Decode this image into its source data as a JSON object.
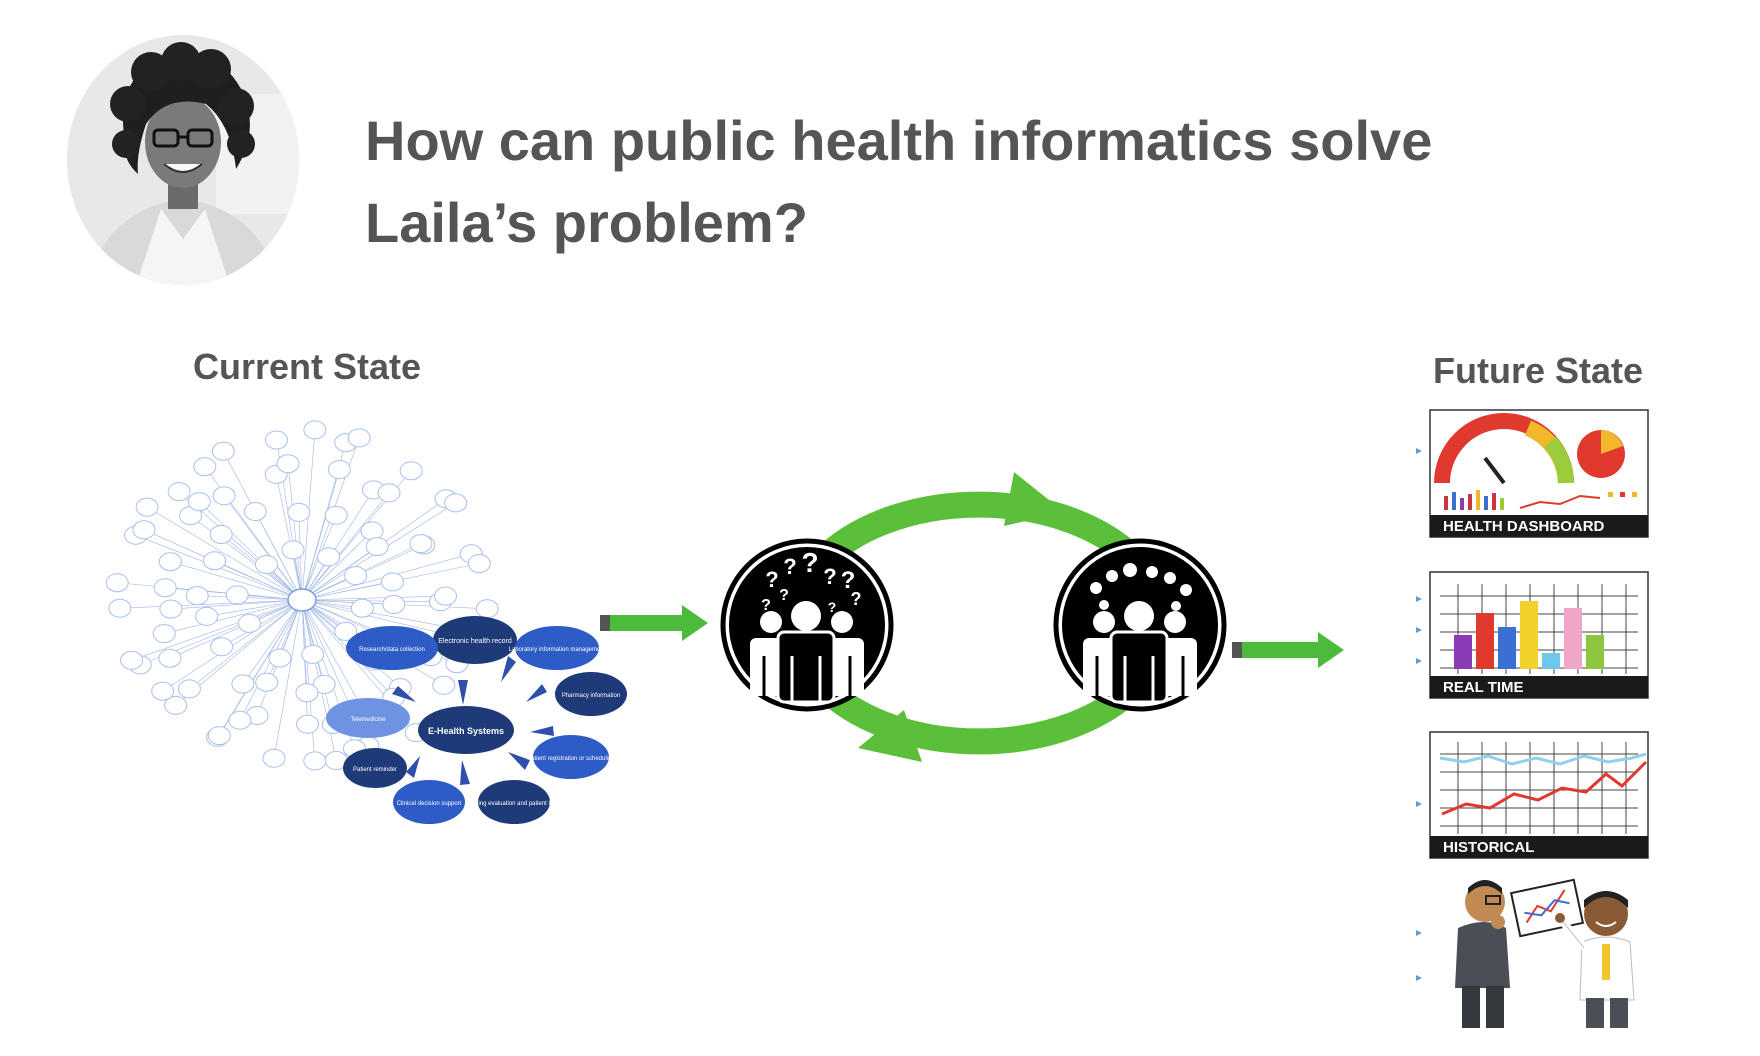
{
  "title": "How can public health informatics solve Laila’s problem?",
  "current_state": {
    "label": "Current State",
    "ehealth_center": "E-Health Systems",
    "ehealth_nodes": [
      "Electronic health record",
      "Laboratory information management",
      "Pharmacy information",
      "Patient registration or scheduling",
      "Monitoring evaluation and patient tracking",
      "Clinical decision support",
      "Patient reminder",
      "Telemedicine",
      "Research/data collection"
    ]
  },
  "future_state": {
    "label": "Future State",
    "panels": [
      "HEALTH DASHBOARD",
      "REAL TIME",
      "HISTORICAL"
    ]
  },
  "colors": {
    "cycle_green": "#5cbf3a",
    "arrow_green": "#4cbb3c",
    "title_gray": "#555555",
    "node_dark": "#1e3a78",
    "node_mid": "#2e5cc7",
    "node_light": "#6f93e3",
    "panel_bar": "#1a1a1a"
  },
  "icons": [
    "person-photo",
    "confused-people-icon",
    "idea-people-icon",
    "discussion-illustration"
  ]
}
